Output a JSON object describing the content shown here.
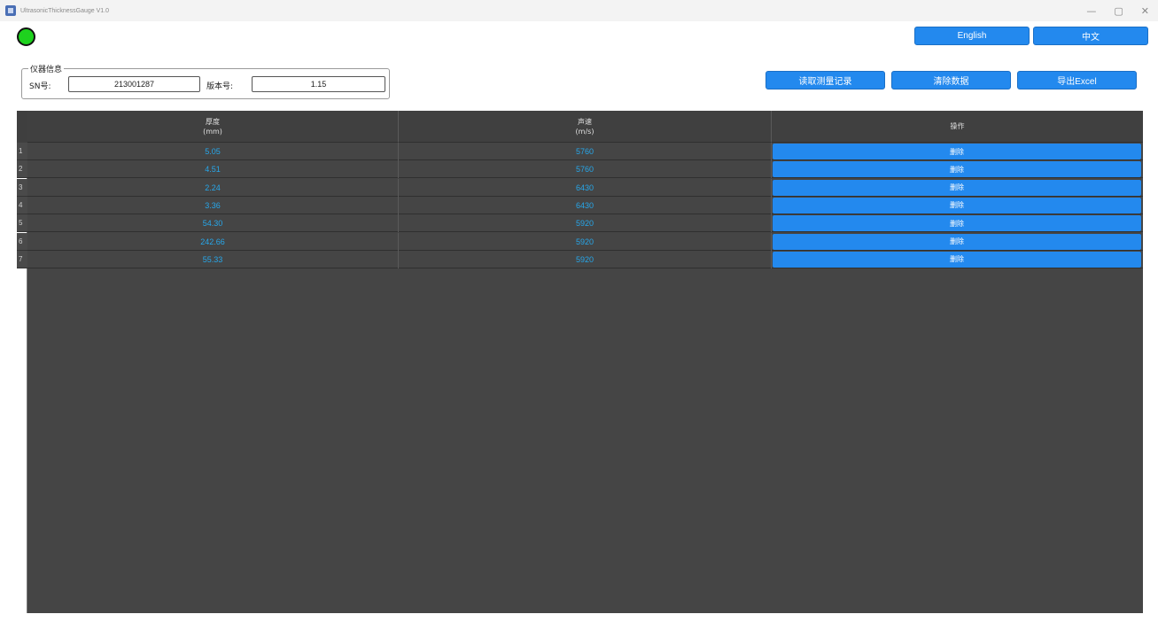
{
  "window": {
    "title": "UltrasonicThicknessGauge V1.0",
    "controls": {
      "minimize": "—",
      "maximize": "▢",
      "close": "✕"
    }
  },
  "status": {
    "led_color": "#1ed21e",
    "state": "connected"
  },
  "language": {
    "english_label": "English",
    "chinese_label": "中文"
  },
  "device_info": {
    "group_title": "仪器信息",
    "sn_label": "SN号:",
    "sn_value": "213001287",
    "version_label": "版本号:",
    "version_value": "1.15"
  },
  "toolbar": {
    "read_label": "读取测量记录",
    "clear_label": "清除数据",
    "export_label": "导出Excel"
  },
  "table": {
    "columns": [
      {
        "line1": "厚度",
        "line2": "(mm)"
      },
      {
        "line1": "声速",
        "line2": "(m/s)"
      },
      {
        "line1": "操作",
        "line2": ""
      }
    ],
    "delete_label": "删除",
    "rows": [
      {
        "index": "1",
        "thickness": "5.05",
        "velocity": "5760"
      },
      {
        "index": "2",
        "thickness": "4.51",
        "velocity": "5760"
      },
      {
        "index": "3",
        "thickness": "2.24",
        "velocity": "6430"
      },
      {
        "index": "4",
        "thickness": "3.36",
        "velocity": "6430"
      },
      {
        "index": "5",
        "thickness": "54.30",
        "velocity": "5920"
      },
      {
        "index": "6",
        "thickness": "242.66",
        "velocity": "5920"
      },
      {
        "index": "7",
        "thickness": "55.33",
        "velocity": "5920"
      }
    ]
  },
  "colors": {
    "accent": "#2389ee",
    "value_text": "#27a7ea",
    "grid_bg": "#454545"
  }
}
